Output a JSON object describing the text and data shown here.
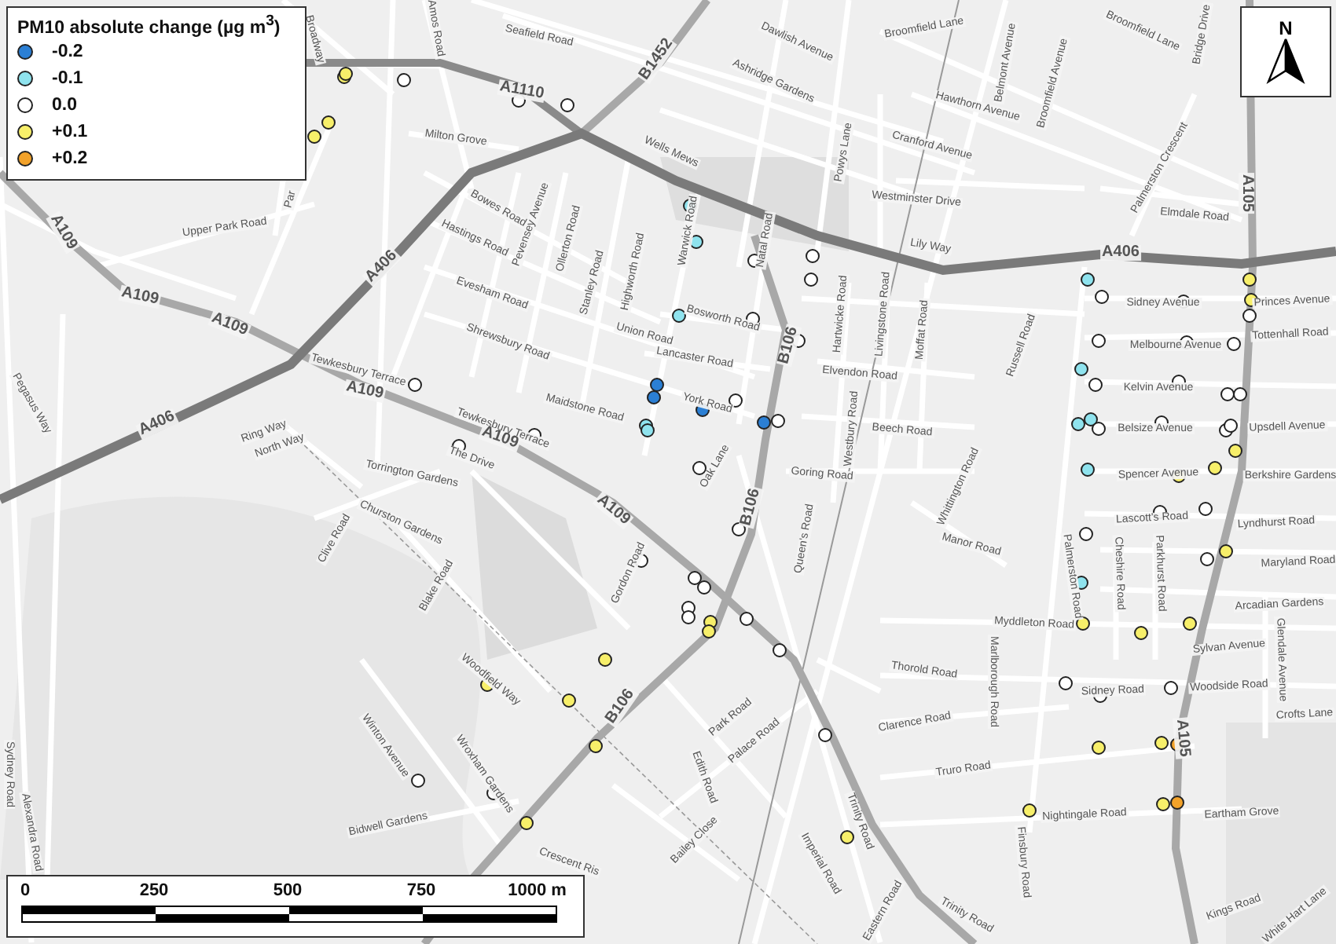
{
  "legend": {
    "title": "PM10 absolute change (µg m$^{3}$)",
    "items": [
      {
        "label": "-0.2",
        "color": "#2b7fd4"
      },
      {
        "label": "-0.1",
        "color": "#8fe3ee"
      },
      {
        "label": "0.0",
        "color": "#ffffff"
      },
      {
        "label": "+0.1",
        "color": "#f7ef6a"
      },
      {
        "label": "+0.2",
        "color": "#f2a22a"
      }
    ]
  },
  "north_arrow": {
    "label": "N"
  },
  "scale_bar": {
    "labels": [
      "0",
      "250",
      "500",
      "750",
      "1000 m"
    ]
  },
  "street_labels": [
    {
      "text": "Broadway",
      "kind": "street"
    },
    {
      "text": "Amos Road",
      "kind": "street"
    },
    {
      "text": "Milton Grove",
      "kind": "street"
    },
    {
      "text": "Par",
      "kind": "street"
    },
    {
      "text": "Upper Park Road",
      "kind": "street"
    },
    {
      "text": "A109",
      "kind": "road"
    },
    {
      "text": "A109",
      "kind": "road"
    },
    {
      "text": "A109",
      "kind": "road"
    },
    {
      "text": "A109",
      "kind": "road"
    },
    {
      "text": "A406",
      "kind": "road"
    },
    {
      "text": "A406",
      "kind": "road"
    },
    {
      "text": "Pegasus Way",
      "kind": "street"
    },
    {
      "text": "Ring Way",
      "kind": "street"
    },
    {
      "text": "North Way",
      "kind": "street"
    },
    {
      "text": "Tewkesbury Terrace",
      "kind": "street"
    },
    {
      "text": "Seafield Road",
      "kind": "street"
    },
    {
      "text": "A1110",
      "kind": "road"
    },
    {
      "text": "B1452",
      "kind": "road"
    },
    {
      "text": "Dawlish Avenue",
      "kind": "street"
    },
    {
      "text": "Ashridge Gardens",
      "kind": "street"
    },
    {
      "text": "Wells Mews",
      "kind": "street"
    },
    {
      "text": "Powys Lane",
      "kind": "street"
    },
    {
      "text": "Bowes Road",
      "kind": "street"
    },
    {
      "text": "Pevensey Avenue",
      "kind": "street"
    },
    {
      "text": "Hastings Road",
      "kind": "street"
    },
    {
      "text": "Ollerton Road",
      "kind": "street"
    },
    {
      "text": "Evesham Road",
      "kind": "street"
    },
    {
      "text": "Stanley Road",
      "kind": "street"
    },
    {
      "text": "Highworth Road",
      "kind": "street"
    },
    {
      "text": "Warwick Road",
      "kind": "street"
    },
    {
      "text": "Natal Road",
      "kind": "street"
    },
    {
      "text": "Shrewsbury Road",
      "kind": "street"
    },
    {
      "text": "Bosworth Road",
      "kind": "street"
    },
    {
      "text": "Union Road",
      "kind": "street"
    },
    {
      "text": "Lancaster Road",
      "kind": "street"
    },
    {
      "text": "B106",
      "kind": "road"
    },
    {
      "text": "Hartwicke Road",
      "kind": "street"
    },
    {
      "text": "Livingstone Road",
      "kind": "street"
    },
    {
      "text": "Elvendon Road",
      "kind": "street"
    },
    {
      "text": "Maidstone Road",
      "kind": "street"
    },
    {
      "text": "York Road",
      "kind": "street"
    },
    {
      "text": "Westbury Road",
      "kind": "street"
    },
    {
      "text": "Tewkesbury Terrace",
      "kind": "street"
    },
    {
      "text": "A109",
      "kind": "road"
    },
    {
      "text": "The Drive",
      "kind": "street"
    },
    {
      "text": "Oak Lane",
      "kind": "street"
    },
    {
      "text": "Goring Road",
      "kind": "street"
    },
    {
      "text": "Torrington Gardens",
      "kind": "street"
    },
    {
      "text": "Churston Gardens",
      "kind": "street"
    },
    {
      "text": "Clive Road",
      "kind": "street"
    },
    {
      "text": "A109",
      "kind": "road"
    },
    {
      "text": "B106",
      "kind": "road"
    },
    {
      "text": "Queen's Road",
      "kind": "street"
    },
    {
      "text": "Gordon Road",
      "kind": "street"
    },
    {
      "text": "Blake Road",
      "kind": "street"
    },
    {
      "text": "Woodfield Way",
      "kind": "street"
    },
    {
      "text": "B106",
      "kind": "road"
    },
    {
      "text": "Park Road",
      "kind": "street"
    },
    {
      "text": "Palace Road",
      "kind": "street"
    },
    {
      "text": "Winton Avenue",
      "kind": "street"
    },
    {
      "text": "Edith Road",
      "kind": "street"
    },
    {
      "text": "Wroxham Gardens",
      "kind": "street"
    },
    {
      "text": "Sydney Road",
      "kind": "street"
    },
    {
      "text": "Bidwell Gardens",
      "kind": "street"
    },
    {
      "text": "Trinity Road",
      "kind": "street"
    },
    {
      "text": "Alexandra Road",
      "kind": "street"
    },
    {
      "text": "Bailey Close",
      "kind": "street"
    },
    {
      "text": "Crescent Ris",
      "kind": "street"
    },
    {
      "text": "Imperial Road",
      "kind": "street"
    },
    {
      "text": "Eastern Road",
      "kind": "street"
    },
    {
      "text": "Broomfield Lane",
      "kind": "street"
    },
    {
      "text": "Belmont Avenue",
      "kind": "street"
    },
    {
      "text": "Broomfield Avenue",
      "kind": "street"
    },
    {
      "text": "Broomfield Lane",
      "kind": "street"
    },
    {
      "text": "Bridge Drive",
      "kind": "street"
    },
    {
      "text": "Hawthorn Avenue",
      "kind": "street"
    },
    {
      "text": "Cranford Avenue",
      "kind": "street"
    },
    {
      "text": "Westminster Drive",
      "kind": "street"
    },
    {
      "text": "Palmerston Crescent",
      "kind": "street"
    },
    {
      "text": "A105",
      "kind": "road"
    },
    {
      "text": "Elmdale Road",
      "kind": "street"
    },
    {
      "text": "Lily Way",
      "kind": "street"
    },
    {
      "text": "A406",
      "kind": "road"
    },
    {
      "text": "Sidney Avenue",
      "kind": "street"
    },
    {
      "text": "Princes Avenue",
      "kind": "street"
    },
    {
      "text": "Moffat Road",
      "kind": "street"
    },
    {
      "text": "Melbourne Avenue",
      "kind": "street"
    },
    {
      "text": "Tottenhall Road",
      "kind": "street"
    },
    {
      "text": "Russell Road",
      "kind": "street"
    },
    {
      "text": "Kelvin Avenue",
      "kind": "street"
    },
    {
      "text": "Beech Road",
      "kind": "street"
    },
    {
      "text": "Belsize Avenue",
      "kind": "street"
    },
    {
      "text": "Upsdell Avenue",
      "kind": "street"
    },
    {
      "text": "Spencer Avenue",
      "kind": "street"
    },
    {
      "text": "Berkshire Gardens",
      "kind": "street"
    },
    {
      "text": "Whittington Road",
      "kind": "street"
    },
    {
      "text": "Lascott's Road",
      "kind": "street"
    },
    {
      "text": "Lyndhurst Road",
      "kind": "street"
    },
    {
      "text": "Manor Road",
      "kind": "street"
    },
    {
      "text": "Palmerston Road",
      "kind": "street"
    },
    {
      "text": "Cheshire Road",
      "kind": "street"
    },
    {
      "text": "Parkhurst Road",
      "kind": "street"
    },
    {
      "text": "Maryland Road",
      "kind": "street"
    },
    {
      "text": "Arcadian Gardens",
      "kind": "street"
    },
    {
      "text": "Myddleton Road",
      "kind": "street"
    },
    {
      "text": "Sylvan Avenue",
      "kind": "street"
    },
    {
      "text": "Glendale Avenue",
      "kind": "street"
    },
    {
      "text": "Marlborough Road",
      "kind": "street"
    },
    {
      "text": "Thorold Road",
      "kind": "street"
    },
    {
      "text": "Sidney Road",
      "kind": "street"
    },
    {
      "text": "Woodside Road",
      "kind": "street"
    },
    {
      "text": "Crofts Lane",
      "kind": "street"
    },
    {
      "text": "A105",
      "kind": "road"
    },
    {
      "text": "Clarence Road",
      "kind": "street"
    },
    {
      "text": "Truro Road",
      "kind": "street"
    },
    {
      "text": "Nightingale Road",
      "kind": "street"
    },
    {
      "text": "Eartham Grove",
      "kind": "street"
    },
    {
      "text": "Finsbury Road",
      "kind": "street"
    },
    {
      "text": "Trinity Road",
      "kind": "street"
    },
    {
      "text": "Kings Road",
      "kind": "street"
    },
    {
      "text": "White Hart Lane",
      "kind": "street"
    }
  ],
  "monitoring_points": [
    {
      "color": "#f7ef6a"
    },
    {
      "color": "#f7ef6a"
    },
    {
      "color": "#ffffff"
    },
    {
      "color": "#f7ef6a"
    },
    {
      "color": "#f7ef6a"
    },
    {
      "color": "#ffffff"
    },
    {
      "color": "#ffffff"
    },
    {
      "color": "#ffffff"
    },
    {
      "color": "#8fe3ee"
    },
    {
      "color": "#8fe3ee"
    },
    {
      "color": "#ffffff"
    },
    {
      "color": "#ffffff"
    },
    {
      "color": "#ffffff"
    },
    {
      "color": "#8fe3ee"
    },
    {
      "color": "#ffffff"
    },
    {
      "color": "#ffffff"
    },
    {
      "color": "#2b7fd4"
    },
    {
      "color": "#2b7fd4"
    },
    {
      "color": "#2b7fd4"
    },
    {
      "color": "#ffffff"
    },
    {
      "color": "#8fe3ee"
    },
    {
      "color": "#8fe3ee"
    },
    {
      "color": "#2b7fd4"
    },
    {
      "color": "#ffffff"
    },
    {
      "color": "#ffffff"
    },
    {
      "color": "#ffffff"
    },
    {
      "color": "#ffffff"
    },
    {
      "color": "#8fe3ee"
    },
    {
      "color": "#ffffff"
    },
    {
      "color": "#ffffff"
    },
    {
      "color": "#f7ef6a"
    },
    {
      "color": "#f7ef6a"
    },
    {
      "color": "#ffffff"
    },
    {
      "color": "#ffffff"
    },
    {
      "color": "#ffffff"
    },
    {
      "color": "#ffffff"
    },
    {
      "color": "#8fe3ee"
    },
    {
      "color": "#ffffff"
    },
    {
      "color": "#ffffff"
    },
    {
      "color": "#ffffff"
    },
    {
      "color": "#ffffff"
    },
    {
      "color": "#8fe3ee"
    },
    {
      "color": "#8fe3ee"
    },
    {
      "color": "#ffffff"
    },
    {
      "color": "#ffffff"
    },
    {
      "color": "#ffffff"
    },
    {
      "color": "#ffffff"
    },
    {
      "color": "#f7ef6a"
    },
    {
      "color": "#f7ef6a"
    },
    {
      "color": "#8fe3ee"
    },
    {
      "color": "#f7ef6a"
    },
    {
      "color": "#ffffff"
    },
    {
      "color": "#ffffff"
    },
    {
      "color": "#ffffff"
    },
    {
      "color": "#f7ef6a"
    },
    {
      "color": "#ffffff"
    },
    {
      "color": "#8fe3ee"
    },
    {
      "color": "#f7ef6a"
    },
    {
      "color": "#f7ef6a"
    },
    {
      "color": "#f7ef6a"
    },
    {
      "color": "#ffffff"
    },
    {
      "color": "#ffffff"
    },
    {
      "color": "#ffffff"
    },
    {
      "color": "#f7ef6a"
    },
    {
      "color": "#f7ef6a"
    },
    {
      "color": "#f2a22a"
    },
    {
      "color": "#f7ef6a"
    },
    {
      "color": "#f2a22a"
    },
    {
      "color": "#f7ef6a"
    },
    {
      "color": "#ffffff"
    },
    {
      "color": "#ffffff"
    },
    {
      "color": "#ffffff"
    },
    {
      "color": "#ffffff"
    },
    {
      "color": "#ffffff"
    },
    {
      "color": "#ffffff"
    },
    {
      "color": "#ffffff"
    },
    {
      "color": "#f7ef6a"
    },
    {
      "color": "#f7ef6a"
    },
    {
      "color": "#ffffff"
    },
    {
      "color": "#ffffff"
    },
    {
      "color": "#f7ef6a"
    },
    {
      "color": "#f7ef6a"
    },
    {
      "color": "#f7ef6a"
    },
    {
      "color": "#f7ef6a"
    },
    {
      "color": "#ffffff"
    },
    {
      "color": "#ffffff"
    },
    {
      "color": "#f7ef6a"
    },
    {
      "color": "#f7ef6a"
    }
  ]
}
